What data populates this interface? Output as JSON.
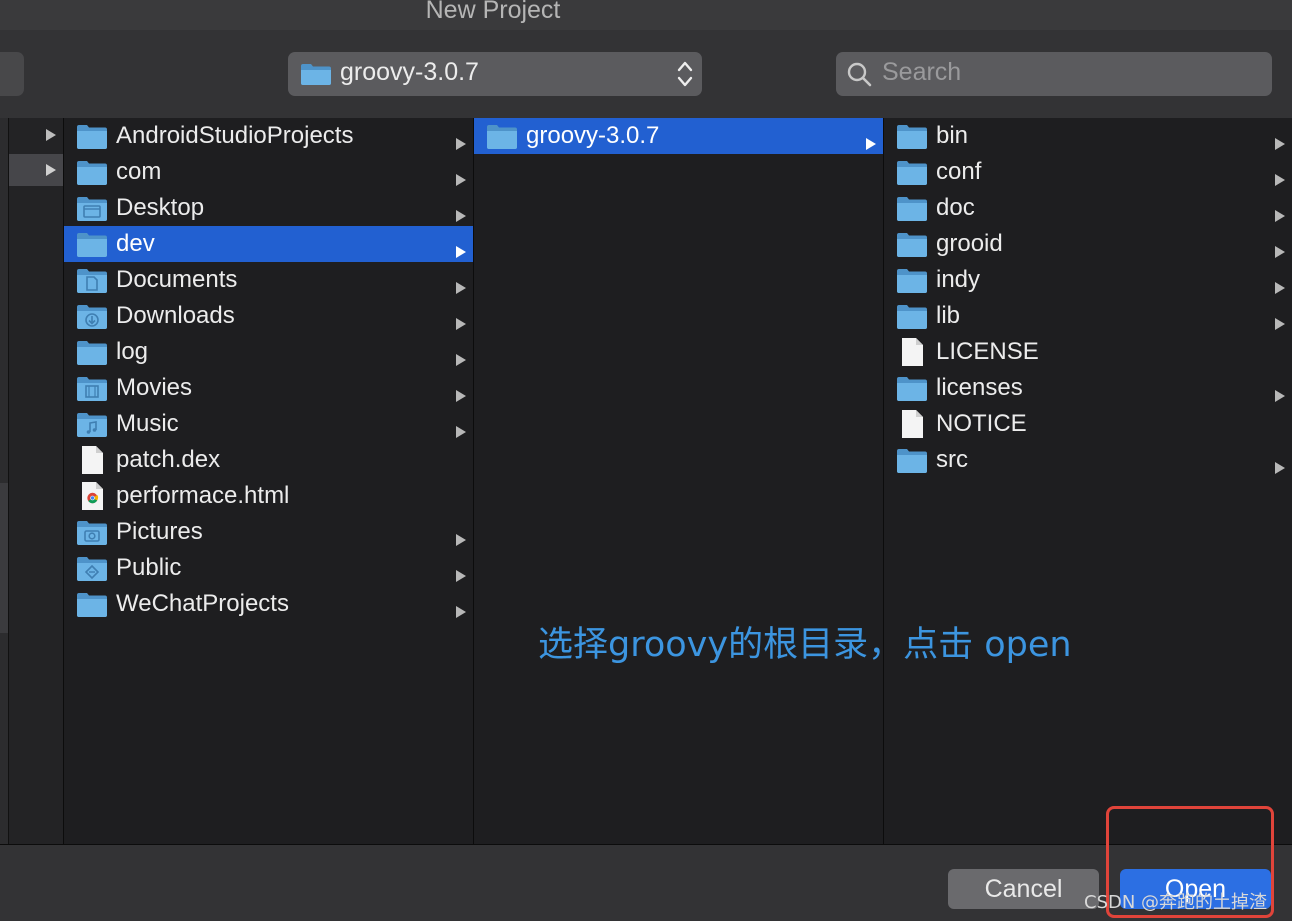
{
  "window": {
    "title": "New Project"
  },
  "toolbar": {
    "path_popup_label": "groovy-3.0.7",
    "search_placeholder": "Search"
  },
  "columns": [
    {
      "items": [
        {
          "name": "AndroidStudioProjects",
          "icon": "folder-icon",
          "has_children": true,
          "selected": false
        },
        {
          "name": "com",
          "icon": "folder-icon",
          "has_children": true,
          "selected": false
        },
        {
          "name": "Desktop",
          "icon": "desktop-folder-icon",
          "has_children": true,
          "selected": false
        },
        {
          "name": "dev",
          "icon": "folder-icon",
          "has_children": true,
          "selected": true
        },
        {
          "name": "Documents",
          "icon": "documents-folder-icon",
          "has_children": true,
          "selected": false
        },
        {
          "name": "Downloads",
          "icon": "downloads-folder-icon",
          "has_children": true,
          "selected": false
        },
        {
          "name": "log",
          "icon": "folder-icon",
          "has_children": true,
          "selected": false
        },
        {
          "name": "Movies",
          "icon": "movies-folder-icon",
          "has_children": true,
          "selected": false
        },
        {
          "name": "Music",
          "icon": "music-folder-icon",
          "has_children": true,
          "selected": false
        },
        {
          "name": "patch.dex",
          "icon": "file-icon",
          "has_children": false,
          "selected": false
        },
        {
          "name": "performace.html",
          "icon": "chrome-html-file-icon",
          "has_children": false,
          "selected": false
        },
        {
          "name": "Pictures",
          "icon": "pictures-folder-icon",
          "has_children": true,
          "selected": false
        },
        {
          "name": "Public",
          "icon": "public-folder-icon",
          "has_children": true,
          "selected": false
        },
        {
          "name": "WeChatProjects",
          "icon": "folder-icon",
          "has_children": true,
          "selected": false
        }
      ]
    },
    {
      "items": [
        {
          "name": "groovy-3.0.7",
          "icon": "folder-icon",
          "has_children": true,
          "selected": true
        }
      ]
    },
    {
      "items": [
        {
          "name": "bin",
          "icon": "folder-icon",
          "has_children": true,
          "selected": false
        },
        {
          "name": "conf",
          "icon": "folder-icon",
          "has_children": true,
          "selected": false
        },
        {
          "name": "doc",
          "icon": "folder-icon",
          "has_children": true,
          "selected": false
        },
        {
          "name": "grooid",
          "icon": "folder-icon",
          "has_children": true,
          "selected": false
        },
        {
          "name": "indy",
          "icon": "folder-icon",
          "has_children": true,
          "selected": false
        },
        {
          "name": "lib",
          "icon": "folder-icon",
          "has_children": true,
          "selected": false
        },
        {
          "name": "LICENSE",
          "icon": "file-icon",
          "has_children": false,
          "selected": false
        },
        {
          "name": "licenses",
          "icon": "folder-icon",
          "has_children": true,
          "selected": false
        },
        {
          "name": "NOTICE",
          "icon": "file-icon",
          "has_children": false,
          "selected": false
        },
        {
          "name": "src",
          "icon": "folder-icon",
          "has_children": true,
          "selected": false
        }
      ]
    }
  ],
  "annotation": {
    "text": "选择groovy的根目录，点击 open"
  },
  "footer": {
    "cancel_label": "Cancel",
    "open_label": "Open"
  },
  "watermark": "CSDN @奔跑的土掉渣",
  "colors": {
    "selection": "#2260d1",
    "folder": "#5fa9dd",
    "open_button": "#2c6fe3",
    "annotation": "#3c95e0",
    "highlight_box": "#e0443a"
  }
}
